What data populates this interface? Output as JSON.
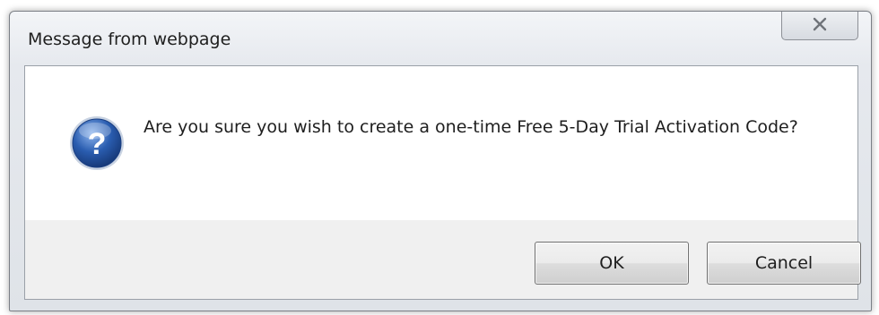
{
  "dialog": {
    "title": "Message from webpage",
    "close_icon": "close-icon",
    "message": "Are you sure you wish to create a one-time Free 5-Day Trial Activation Code?",
    "icon": "question-icon",
    "buttons": {
      "ok_label": "OK",
      "cancel_label": "Cancel"
    }
  },
  "colors": {
    "icon_blue": "#2a5db0",
    "content_bg": "#ffffff",
    "footer_bg": "#f0f0f0"
  }
}
